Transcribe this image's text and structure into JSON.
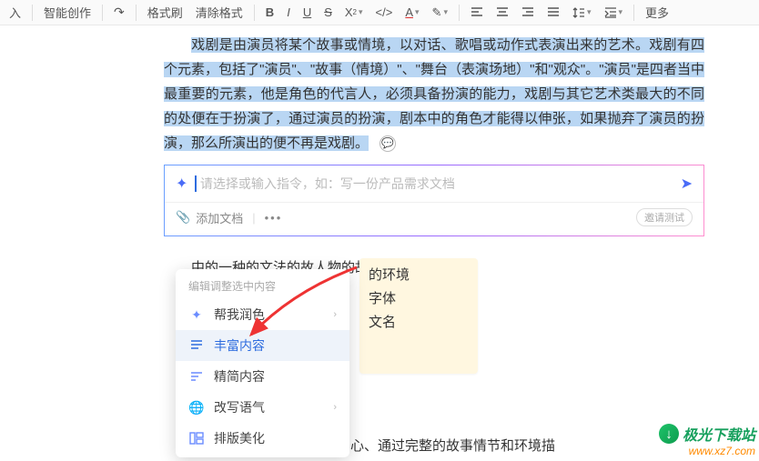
{
  "toolbar": {
    "insert": "入",
    "ai_create": "智能创作",
    "format_painter": "格式刷",
    "clear_format": "清除格式",
    "more": "更多"
  },
  "document": {
    "paragraph": "戏剧是由演员将某个故事或情境，以对话、歌唱或动作式表演出来的艺术。戏剧有四个元素，包括了\"演员\"、\"故事（情境）\"、\"舞台（表演场地）\"和\"观众\"。\"演员\"是四者当中最重要的元素，他是角色的代言人，必须具备扮演的能力，戏剧与其它艺术类最大的不同的处便在于扮演了，通过演员的扮演，剧本中的角色才能得以伸张，如果抛弃了演员的扮演，那么所演出的便不再是戏剧。"
  },
  "ai": {
    "placeholder_prefix": "请选择或输入指令，如：",
    "placeholder_example": "写一份产品需求文档",
    "attach": "添加文档",
    "invite": "邀请测试"
  },
  "truncated_line": "中的一种的文法的故人物的故（八个",
  "suggestion": {
    "item1": "的环境",
    "item2": "字体",
    "item3": "文名"
  },
  "dropdown": {
    "header": "编辑调整选中内容",
    "polish": "帮我润色",
    "enrich": "丰富内容",
    "simplify": "精简内容",
    "tone": "改写语气",
    "layout": "排版美化"
  },
  "bottom_text": "物形象为中心、通过完整的故事情节和环境描",
  "watermark": {
    "name": "极光下载站",
    "url": "www.xz7.com"
  }
}
